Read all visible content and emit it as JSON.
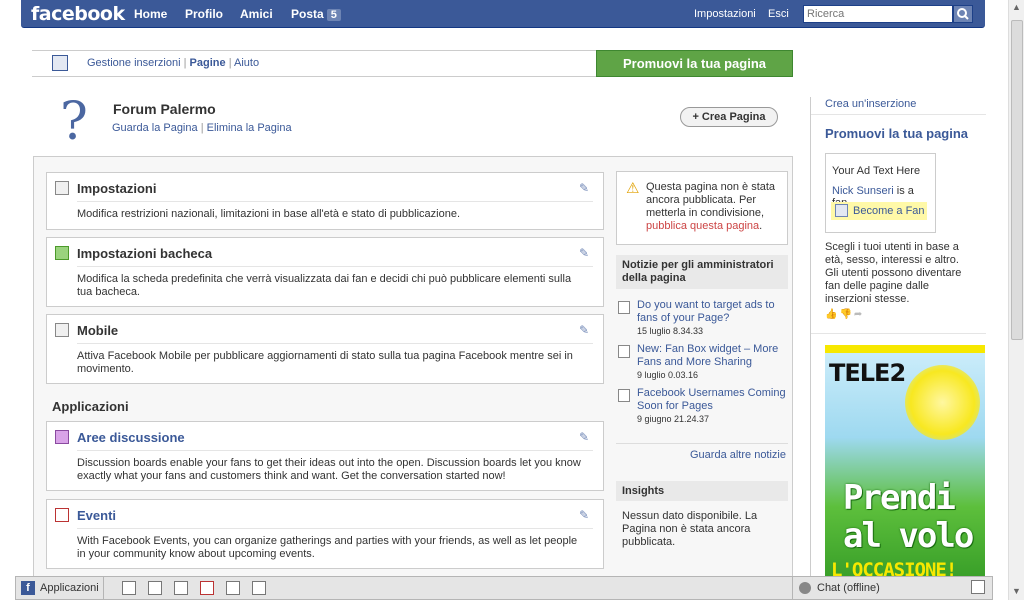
{
  "topbar": {
    "logo": "facebook",
    "nav": [
      "Home",
      "Profilo",
      "Amici",
      "Posta"
    ],
    "mail_count": "5",
    "settings": "Impostazioni",
    "logout": "Esci",
    "search_placeholder": "Ricerca"
  },
  "subbar": {
    "links": [
      "Gestione inserzioni",
      "Pagine",
      "Aiuto"
    ],
    "promote_button": "Promuovi la tua pagina"
  },
  "page": {
    "title": "Forum Palermo",
    "view_link": "Guarda la Pagina",
    "delete_link": "Elimina la Pagina",
    "create_button": "+ Crea Pagina"
  },
  "settings_cards": [
    {
      "title": "Impostazioni",
      "desc": "Modifica restrizioni nazionali, limitazioni in base all'età e stato di pubblicazione."
    },
    {
      "title": "Impostazioni bacheca",
      "desc": "Modifica la scheda predefinita che verrà visualizzata dai fan e decidi chi può pubblicare elementi sulla tua bacheca."
    },
    {
      "title": "Mobile",
      "desc": "Attiva Facebook Mobile per pubblicare aggiornamenti di stato sulla tua pagina Facebook mentre sei in movimento."
    }
  ],
  "apps_heading": "Applicazioni",
  "app_cards": [
    {
      "title": "Aree discussione",
      "desc": "Discussion boards enable your fans to get their ideas out into the open. Discussion boards let you know exactly what your fans and customers think and want. Get the conversation started now!"
    },
    {
      "title": "Eventi",
      "desc": "With Facebook Events, you can organize gatherings and parties with your friends, as well as let people in your community know about upcoming events."
    }
  ],
  "warning": {
    "text": "Questa pagina non è stata ancora pubblicata. Per metterla in condivisione,",
    "link": "pubblica questa pagina",
    "end": "."
  },
  "news": {
    "heading": "Notizie per gli amministratori della pagina",
    "items": [
      {
        "title": "Do you want to target ads to fans of your Page?",
        "date": "15 luglio 8.34.33"
      },
      {
        "title": "New: Fan Box widget – More Fans and More Sharing",
        "date": "9 luglio 0.03.16"
      },
      {
        "title": "Facebook Usernames Coming Soon for Pages",
        "date": "9 giugno 21.24.37"
      }
    ],
    "more": "Guarda altre notizie"
  },
  "insights": {
    "heading": "Insights",
    "text": "Nessun dato disponibile. La Pagina non è stata ancora pubblicata."
  },
  "sidebar": {
    "create_ad": "Crea un'inserzione",
    "title": "Promuovi la tua pagina",
    "ad_text": "Your Ad Text Here",
    "fan_name": "Nick Sunseri",
    "fan_suffix": " is a fan.",
    "become_fan": "Become a Fan",
    "desc": "Scegli i tuoi utenti in base a età, sesso, interessi e altro. Gli utenti possono diventare fan delle pagine dalle inserzioni stesse."
  },
  "tele2_ad": {
    "brand": "TELE2",
    "headline": "Prendi al volo",
    "subline": "L'OCCASIONE!"
  },
  "chatbar": {
    "apps": "Applicazioni",
    "chat": "Chat (offline)"
  }
}
